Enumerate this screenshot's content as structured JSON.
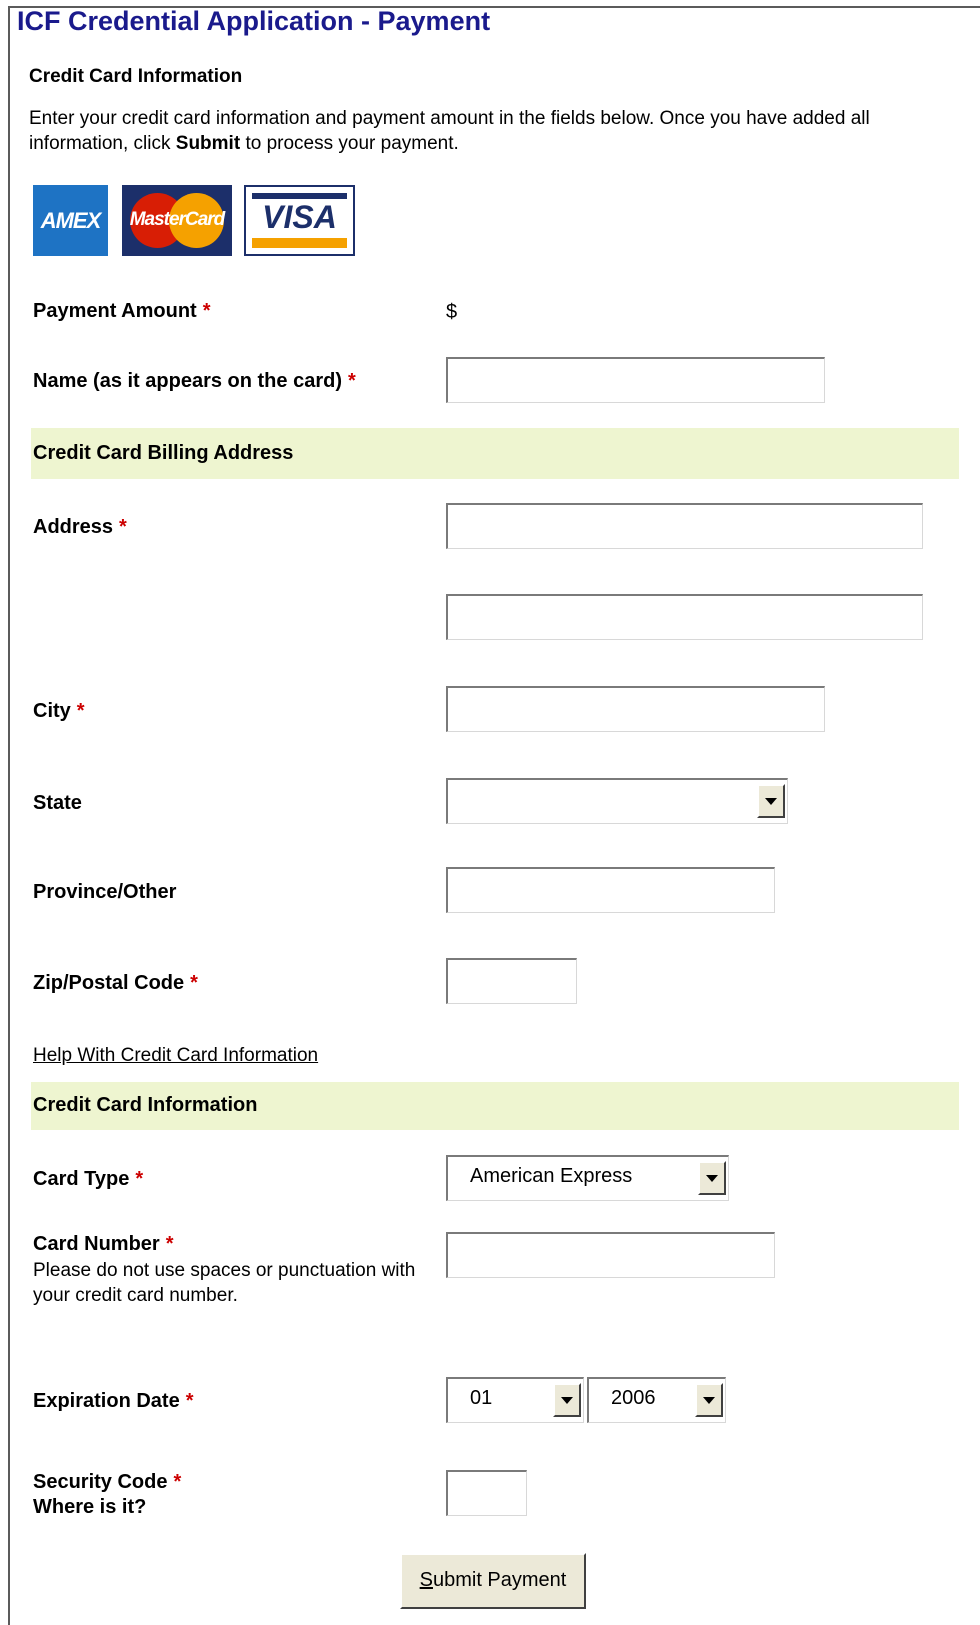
{
  "page": {
    "title": "ICF Credential Application - Payment",
    "section_title": "Credit Card Information",
    "intro_part1": "Enter your credit card information and payment amount in the fields below. Once you have added all information, click ",
    "intro_bold": "Submit",
    "intro_part2": " to process your payment."
  },
  "logos": {
    "amex": "AMEX",
    "mastercard": "MasterCard",
    "visa": "VISA"
  },
  "payment": {
    "amount_label": "Payment Amount",
    "currency_symbol": "$",
    "name_label": "Name (as it appears on the card)",
    "required_mark": "*"
  },
  "billing": {
    "band_title": "Credit Card Billing Address",
    "address_label": "Address",
    "city_label": "City",
    "state_label": "State",
    "state_value": "",
    "province_label": "Province/Other",
    "zip_label": "Zip/Postal Code"
  },
  "help_link": "Help With Credit Card Information",
  "card": {
    "band_title": "Credit Card Information",
    "type_label": "Card Type",
    "type_value": "American Express",
    "number_label": "Card Number",
    "number_hint": "Please do not use spaces or punctuation with your credit card number.",
    "expiration_label": "Expiration Date",
    "exp_month": "01",
    "exp_year": "2006",
    "security_label": "Security Code",
    "security_hint": "Where is it?"
  },
  "submit": {
    "pre": "",
    "underlined": "S",
    "post": "ubmit Payment"
  }
}
